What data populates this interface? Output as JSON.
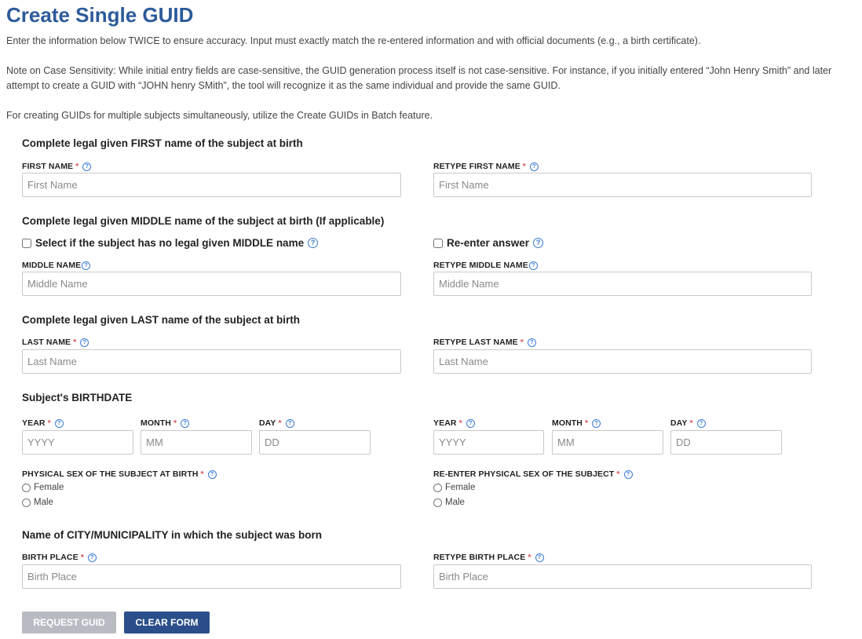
{
  "title": "Create Single GUID",
  "intro": {
    "p1": "Enter the information below TWICE to ensure accuracy. Input must exactly match the re-entered information and with official documents (e.g., a birth certificate).",
    "p2": "Note on Case Sensitivity: While initial entry fields are case-sensitive, the GUID generation process itself is not case-sensitive. For instance, if you initially entered “John Henry Smith” and later attempt to create a GUID with “JOHN henry SMith”, the tool will recognize it as the same individual and provide the same GUID.",
    "p3": "For creating GUIDs for multiple subjects simultaneously, utilize the Create GUIDs in Batch feature."
  },
  "first": {
    "heading": "Complete legal given FIRST name of the subject at birth",
    "label": "FIRST NAME",
    "retype_label": "RETYPE FIRST NAME",
    "placeholder": "First Name",
    "retype_placeholder": "First Name"
  },
  "middle": {
    "heading": "Complete legal given MIDDLE name of the subject at birth (If applicable)",
    "no_middle_label": "Select if the subject has no legal given MIDDLE name",
    "reenter_label": "Re-enter answer",
    "label": "MIDDLE NAME",
    "retype_label": "RETYPE MIDDLE NAME",
    "placeholder": "Middle Name",
    "retype_placeholder": "Middle Name"
  },
  "last": {
    "heading": "Complete legal given LAST name of the subject at birth",
    "label": "LAST NAME",
    "retype_label": "RETYPE LAST NAME",
    "placeholder": "Last Name",
    "retype_placeholder": "Last Name"
  },
  "birthdate": {
    "heading": "Subject's BIRTHDATE",
    "year_label": "YEAR",
    "month_label": "MONTH",
    "day_label": "DAY",
    "year_placeholder": "YYYY",
    "month_placeholder": "MM",
    "day_placeholder": "DD"
  },
  "sex": {
    "label": "PHYSICAL SEX OF THE SUBJECT AT BIRTH",
    "retype_label": "RE-ENTER PHYSICAL SEX OF THE SUBJECT",
    "options": [
      "Female",
      "Male"
    ]
  },
  "birthplace": {
    "heading": "Name of CITY/MUNICIPALITY in which the subject was born",
    "label": "BIRTH PLACE",
    "retype_label": "RETYPE BIRTH PLACE",
    "placeholder": "Birth Place",
    "retype_placeholder": "Birth Place"
  },
  "required_mark": "*",
  "help_glyph": "?",
  "buttons": {
    "request": "REQUEST GUID",
    "clear": "CLEAR FORM"
  },
  "colors": {
    "title": "#2d5b9a",
    "required": "#d9534f",
    "help": "#3a7bd5",
    "request_button_disabled": "#b8bcc2",
    "clear_button": "#2a4f8a"
  }
}
